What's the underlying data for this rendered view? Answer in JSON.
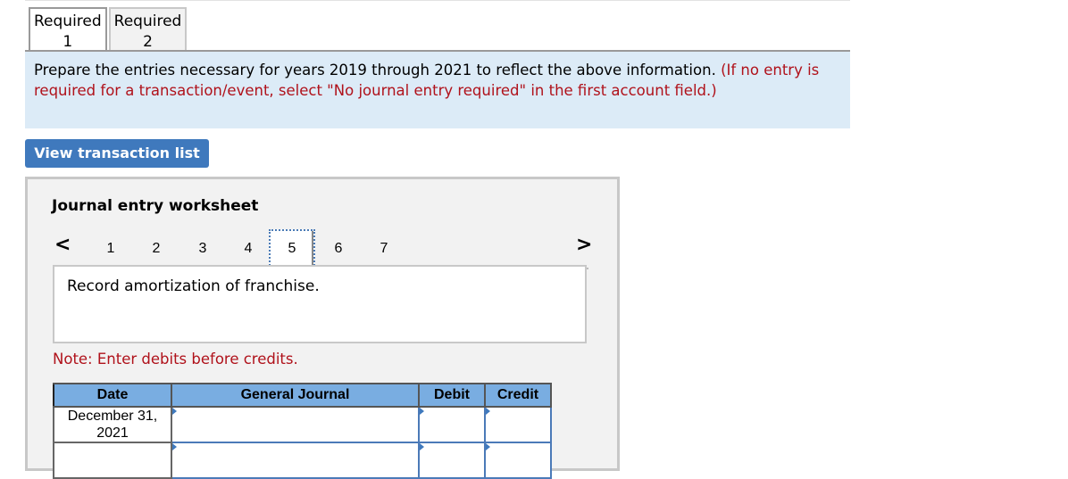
{
  "tabs": [
    {
      "line1": "Required",
      "line2": "1",
      "active": true
    },
    {
      "line1": "Required",
      "line2": "2",
      "active": false
    }
  ],
  "instructions": {
    "text": "Prepare the entries necessary for years 2019 through 2021 to reflect the above information.",
    "red_text": "(If no entry is required for a transaction/event, select \"No journal entry required\" in the first account field.)"
  },
  "view_button": "View transaction list",
  "worksheet": {
    "title": "Journal entry worksheet",
    "prev_icon": "<",
    "next_icon": ">",
    "pages": [
      "1",
      "2",
      "3",
      "4",
      "5",
      "6",
      "7"
    ],
    "active_page": "5",
    "description": "Record amortization of franchise.",
    "note": "Note: Enter debits before credits."
  },
  "journal": {
    "headers": [
      "Date",
      "General Journal",
      "Debit",
      "Credit"
    ],
    "rows": [
      {
        "date": "December 31, 2021",
        "account": "",
        "debit": "",
        "credit": ""
      },
      {
        "date": "",
        "account": "",
        "debit": "",
        "credit": ""
      }
    ]
  }
}
